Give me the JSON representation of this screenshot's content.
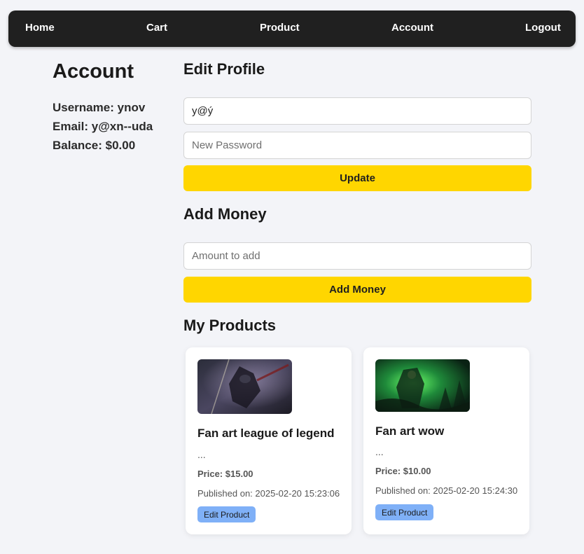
{
  "nav": {
    "home": "Home",
    "cart": "Cart",
    "product": "Product",
    "account": "Account",
    "logout": "Logout"
  },
  "account": {
    "title": "Account",
    "username_label": "Username:",
    "username": "ynov",
    "email_label": "Email:",
    "email": "y@xn--uda",
    "balance_label": "Balance:",
    "balance": "$0.00"
  },
  "edit_profile": {
    "title": "Edit Profile",
    "email_value": "y@ý",
    "password_placeholder": "New Password",
    "update_label": "Update"
  },
  "add_money": {
    "title": "Add Money",
    "amount_placeholder": "Amount to add",
    "button_label": "Add Money"
  },
  "my_products": {
    "title": "My Products",
    "items": [
      {
        "name": "Fan art league of legend",
        "description": "...",
        "price_label": "Price:",
        "price": "$15.00",
        "published_label": "Published on:",
        "published": "2025-02-20 15:23:06",
        "edit_label": "Edit Product",
        "image_icon": "league-fan-art-image"
      },
      {
        "name": "Fan art wow",
        "description": "...",
        "price_label": "Price:",
        "price": "$10.00",
        "published_label": "Published on:",
        "published": "2025-02-20 15:24:30",
        "edit_label": "Edit Product",
        "image_icon": "wow-fan-art-image"
      }
    ]
  },
  "colors": {
    "navbar": "#202020",
    "accent_yellow": "#ffd600",
    "edit_button": "#7fb0f7",
    "background": "#f3f4f8"
  }
}
